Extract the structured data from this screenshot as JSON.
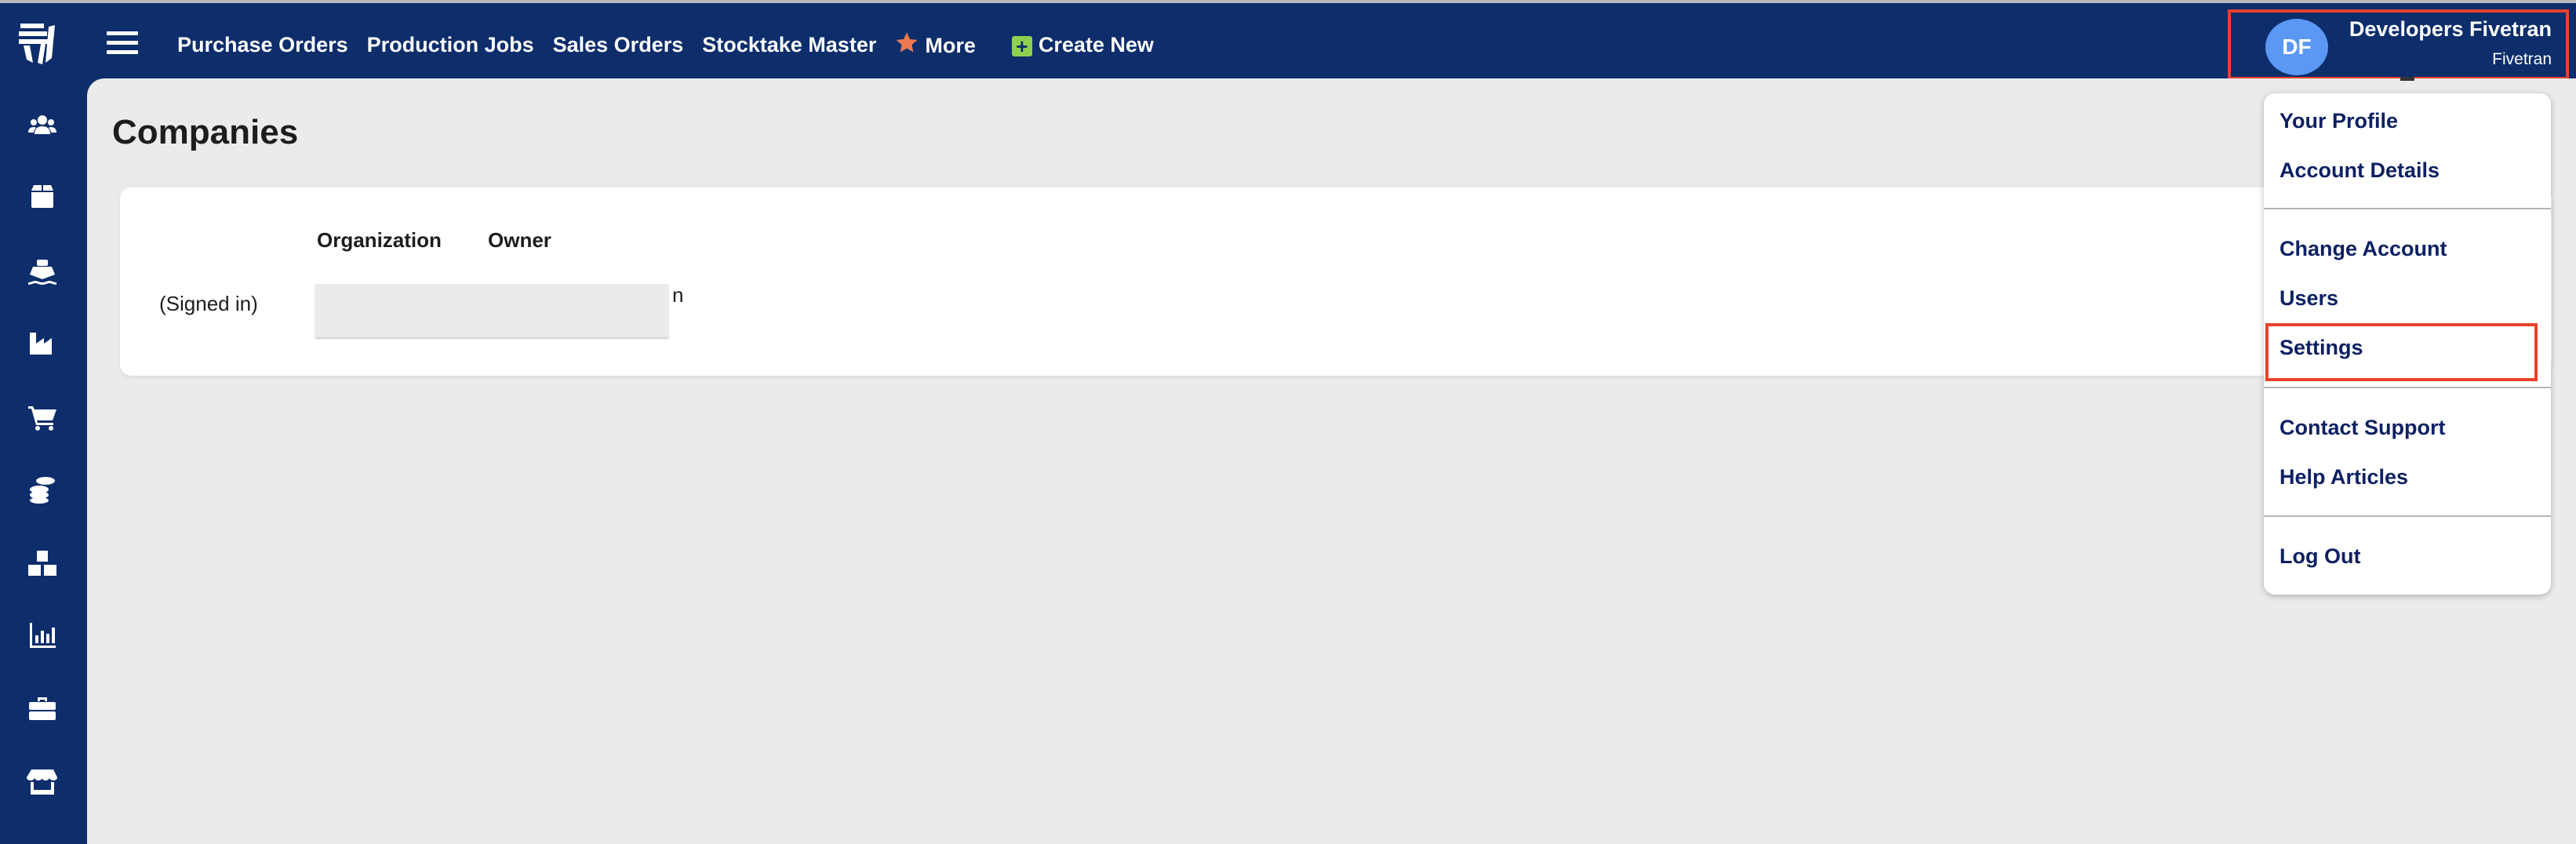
{
  "topbar": {
    "nav": [
      "Purchase Orders",
      "Production Jobs",
      "Sales Orders",
      "Stocktake Master",
      "More",
      "Create New"
    ],
    "icons": {
      "more": "star-icon",
      "create": "plus-square-icon"
    },
    "user": {
      "initials": "DF",
      "name": "Developers Fivetran",
      "org": "Fivetran"
    }
  },
  "sidebar": {
    "icons": [
      "users-icon",
      "box-icon",
      "ship-icon",
      "factory-icon",
      "cart-icon",
      "coins-icon",
      "boxes-icon",
      "chart-icon",
      "briefcase-icon",
      "store-icon"
    ]
  },
  "main": {
    "title": "Companies",
    "columns": [
      "Organization",
      "Owner"
    ],
    "row": {
      "status": "(Signed in)",
      "owner_fragment": "n"
    }
  },
  "dropdown": {
    "items": [
      "Your Profile",
      "Account Details",
      "Change Account",
      "Users",
      "Settings",
      "Contact Support",
      "Help Articles",
      "Log Out"
    ],
    "highlighted": "Settings"
  },
  "colors": {
    "navy": "#0d2d6b",
    "highlight": "#e8412c",
    "avatar": "#5b97f4",
    "star": "#f07a4f",
    "create": "#8fd14f"
  }
}
